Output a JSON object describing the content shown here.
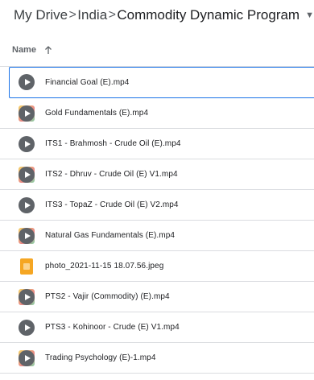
{
  "breadcrumb": {
    "items": [
      "My Drive",
      "India",
      "Commodity Dynamic Program"
    ],
    "separator": ">"
  },
  "list_header": {
    "name_label": "Name",
    "sort": "ascending"
  },
  "files": [
    {
      "name": "Financial Goal (E).mp4",
      "type": "video",
      "selected": true
    },
    {
      "name": "Gold Fundamentals (E).mp4",
      "type": "video"
    },
    {
      "name": "ITS1 - Brahmosh - Crude Oil (E).mp4",
      "type": "video"
    },
    {
      "name": "ITS2 - Dhruv - Crude Oil (E) V1.mp4",
      "type": "video"
    },
    {
      "name": "ITS3 - TopaZ - Crude Oil (E) V2.mp4",
      "type": "video"
    },
    {
      "name": "Natural Gas Fundamentals (E).mp4",
      "type": "video"
    },
    {
      "name": "photo_2021-11-15 18.07.56.jpeg",
      "type": "image"
    },
    {
      "name": "PTS2 - Vajir (Commodity) (E).mp4",
      "type": "video"
    },
    {
      "name": "PTS3 - Kohinoor - Crude (E) V1.mp4",
      "type": "video"
    },
    {
      "name": "Trading Psychology (E)-1.mp4",
      "type": "video"
    }
  ],
  "colors": {
    "selection": "#1a73e8",
    "divider": "#dadce0",
    "image_icon": "#f5a623"
  }
}
